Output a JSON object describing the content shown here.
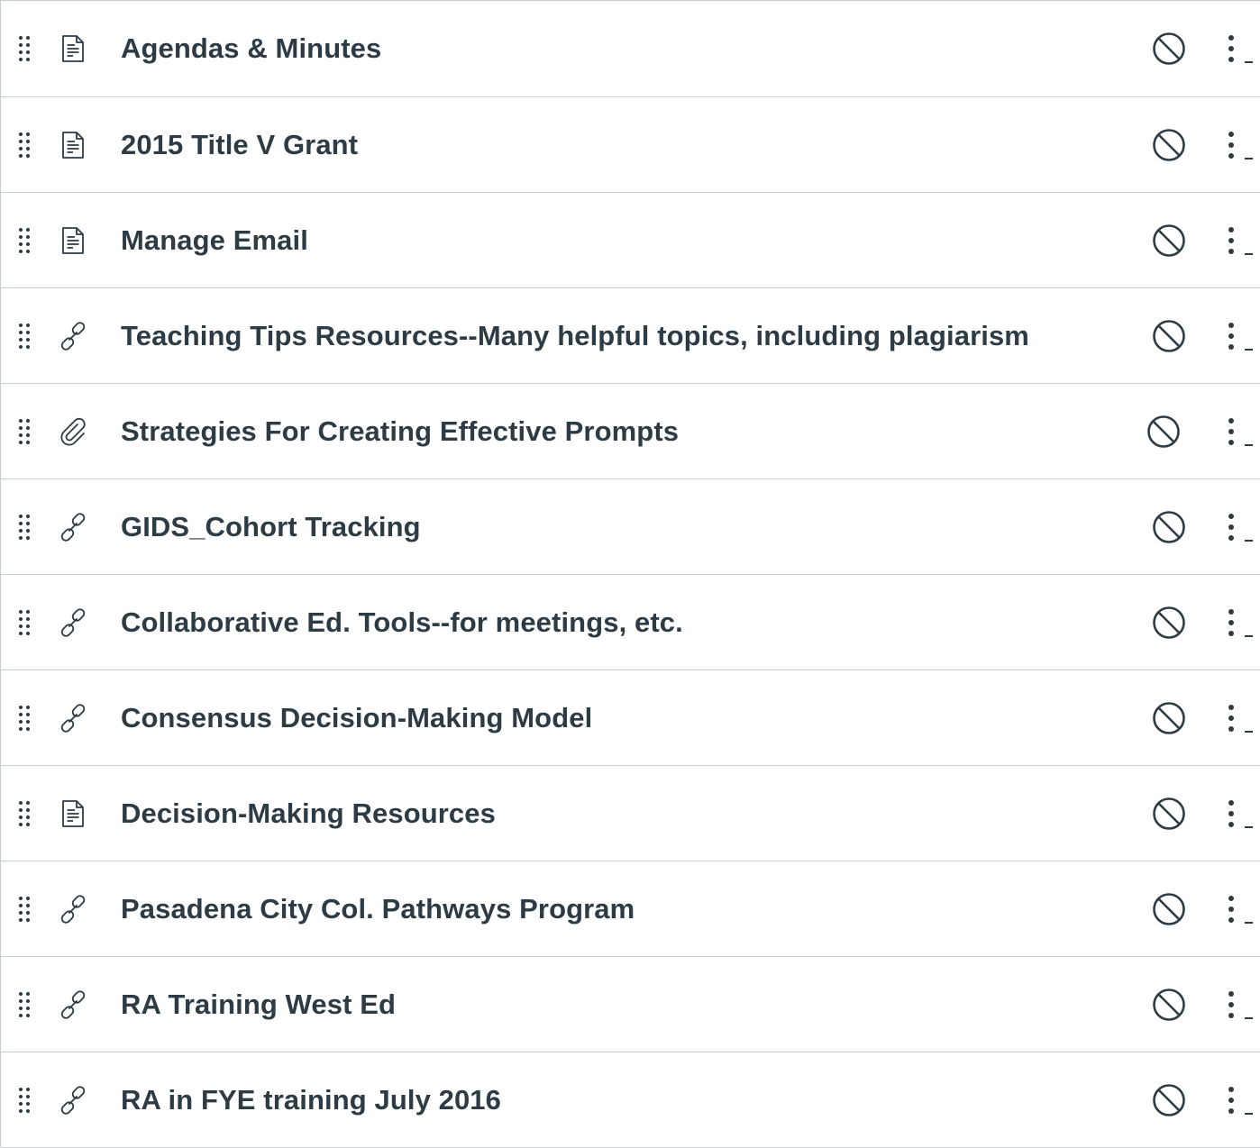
{
  "module_items": [
    {
      "title": "Agendas & Minutes",
      "type": "page",
      "type_icon": "document-icon",
      "status_icon": "unpublished-icon"
    },
    {
      "title": "2015 Title V Grant",
      "type": "page",
      "type_icon": "document-icon",
      "status_icon": "unpublished-icon"
    },
    {
      "title": "Manage Email",
      "type": "page",
      "type_icon": "document-icon",
      "status_icon": "unpublished-icon"
    },
    {
      "title": "Teaching Tips Resources--Many helpful topics, including plagiarism",
      "type": "link",
      "type_icon": "link-icon",
      "status_icon": "unpublished-icon"
    },
    {
      "title": "Strategies For Creating Effective Prompts",
      "type": "file",
      "type_icon": "paperclip-icon",
      "status_icon": "unpublished-icon"
    },
    {
      "title": "GIDS_Cohort Tracking",
      "type": "link",
      "type_icon": "link-icon",
      "status_icon": "unpublished-icon"
    },
    {
      "title": "Collaborative Ed. Tools--for meetings, etc.",
      "type": "link",
      "type_icon": "link-icon",
      "status_icon": "unpublished-icon"
    },
    {
      "title": "Consensus Decision-Making Model",
      "type": "link",
      "type_icon": "link-icon",
      "status_icon": "unpublished-icon"
    },
    {
      "title": "Decision-Making Resources",
      "type": "page",
      "type_icon": "document-icon",
      "status_icon": "unpublished-icon"
    },
    {
      "title": "Pasadena City Col. Pathways Program",
      "type": "link",
      "type_icon": "link-icon",
      "status_icon": "unpublished-icon"
    },
    {
      "title": "RA Training West Ed",
      "type": "link",
      "type_icon": "link-icon",
      "status_icon": "unpublished-icon"
    },
    {
      "title": "RA in FYE training July 2016",
      "type": "link",
      "type_icon": "link-icon",
      "status_icon": "unpublished-icon"
    }
  ],
  "colors": {
    "text": "#2d3b45",
    "icon": "#2d3b45",
    "divider": "#c7cdd1",
    "background": "#ffffff"
  }
}
